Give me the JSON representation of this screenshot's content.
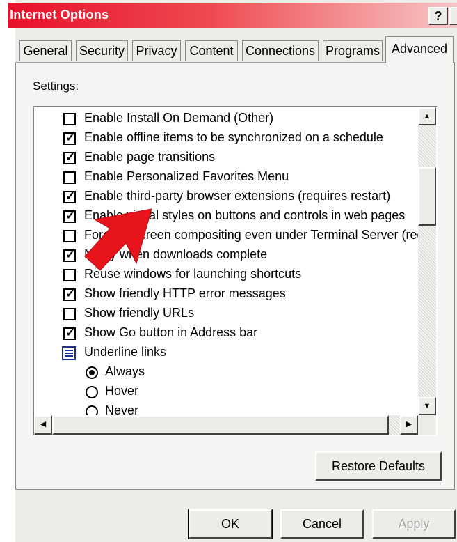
{
  "window": {
    "title": "Internet Options",
    "help_label": "?",
    "accent_color": "#e8102a"
  },
  "tabs": [
    {
      "label": "General"
    },
    {
      "label": "Security"
    },
    {
      "label": "Privacy"
    },
    {
      "label": "Content"
    },
    {
      "label": "Connections"
    },
    {
      "label": "Programs"
    },
    {
      "label": "Advanced",
      "active": true
    }
  ],
  "settings": {
    "label": "Settings:",
    "items": [
      {
        "type": "checkbox",
        "checked": false,
        "label": "Enable Install On Demand (Other)"
      },
      {
        "type": "checkbox",
        "checked": true,
        "label": "Enable offline items to be synchronized on a schedule"
      },
      {
        "type": "checkbox",
        "checked": true,
        "label": "Enable page transitions"
      },
      {
        "type": "checkbox",
        "checked": false,
        "label": "Enable Personalized Favorites Menu"
      },
      {
        "type": "checkbox",
        "checked": true,
        "label": "Enable third-party browser extensions (requires restart)"
      },
      {
        "type": "checkbox",
        "checked": true,
        "label": "Enable visual styles on buttons and controls in web pages"
      },
      {
        "type": "checkbox",
        "checked": false,
        "label": "Force offscreen compositing even under Terminal Server (requ"
      },
      {
        "type": "checkbox",
        "checked": true,
        "label": "Notify when downloads complete"
      },
      {
        "type": "checkbox",
        "checked": false,
        "label": "Reuse windows for launching shortcuts"
      },
      {
        "type": "checkbox",
        "checked": true,
        "label": "Show friendly HTTP error messages"
      },
      {
        "type": "checkbox",
        "checked": false,
        "label": "Show friendly URLs"
      },
      {
        "type": "checkbox",
        "checked": true,
        "label": "Show Go button in Address bar"
      },
      {
        "type": "group",
        "label": "Underline links",
        "icon": "settings-group-icon"
      },
      {
        "type": "radio",
        "selected": true,
        "label": "Always"
      },
      {
        "type": "radio",
        "selected": false,
        "label": "Hover"
      },
      {
        "type": "radio",
        "selected": false,
        "label": "Never"
      }
    ]
  },
  "buttons": {
    "restore_defaults": "Restore Defaults",
    "ok": "OK",
    "cancel": "Cancel",
    "apply": "Apply"
  },
  "annotation": {
    "icon": "red-arrow-icon",
    "color": "#e8141c"
  }
}
